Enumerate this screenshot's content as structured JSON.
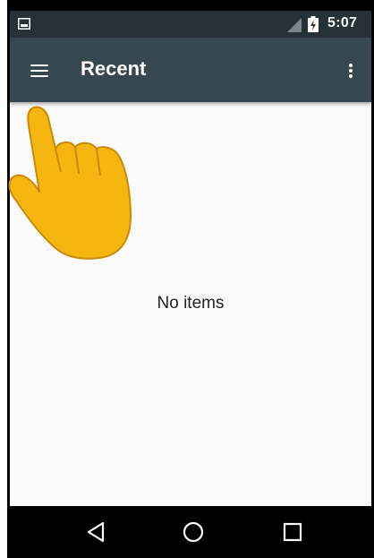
{
  "status_bar": {
    "time": "5:07",
    "icons": [
      "image-notification-icon",
      "signal-icon",
      "battery-charging-icon"
    ]
  },
  "app_bar": {
    "title": "Recent",
    "menu_icon": "hamburger-menu-icon",
    "overflow_icon": "more-vert-icon"
  },
  "content": {
    "empty_message": "No items"
  },
  "nav_bar": {
    "buttons": [
      "back-icon",
      "home-icon",
      "recents-icon"
    ]
  },
  "overlay": {
    "icon": "pointing-hand-icon",
    "color": "#f5b70f"
  },
  "colors": {
    "status_bar": "#263238",
    "app_bar": "#37474f",
    "background": "#fafafa"
  }
}
